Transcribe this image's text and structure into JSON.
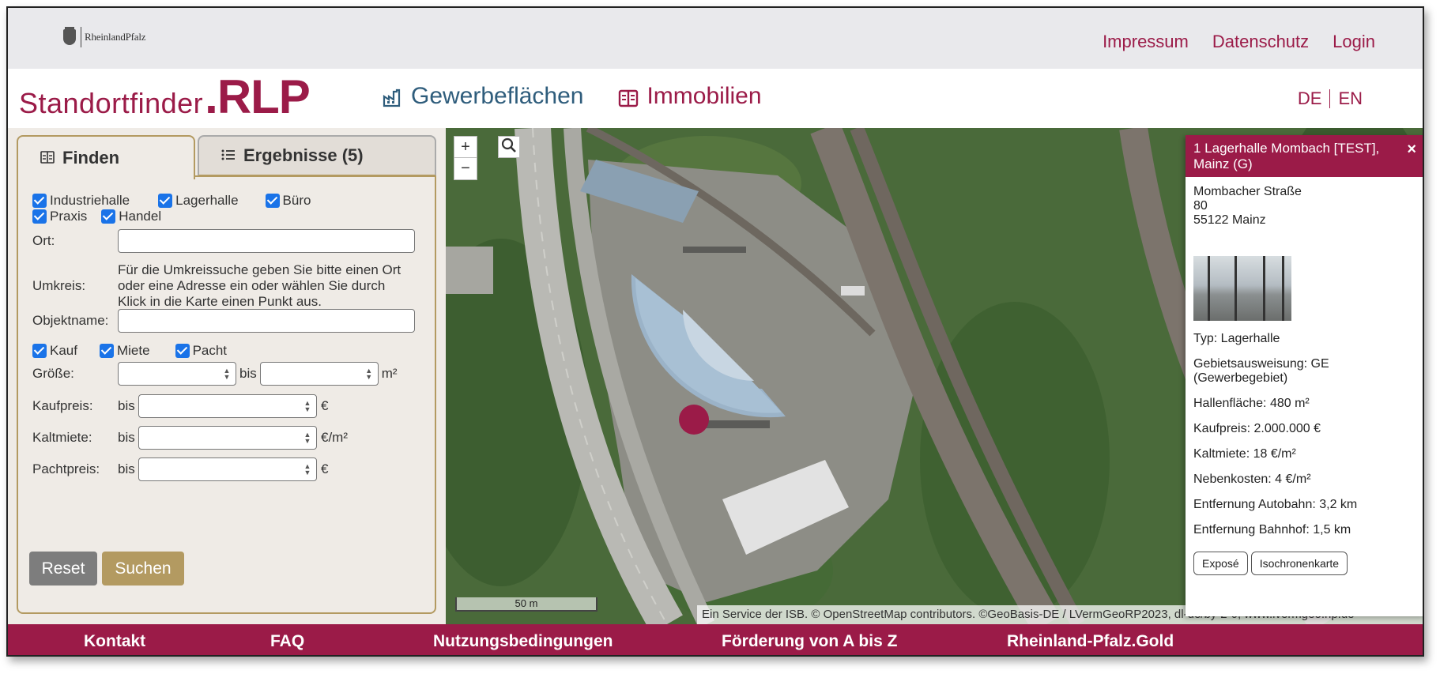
{
  "topbar": {
    "logo_text": "RheinlandPfalz",
    "links": [
      "Impressum",
      "Datenschutz",
      "Login"
    ]
  },
  "header": {
    "brand_prefix": "Standortfinder",
    "brand_suffix": ".RLP",
    "nav": [
      {
        "label": "Gewerbeflächen",
        "icon": "factory-icon"
      },
      {
        "label": "Immobilien",
        "icon": "building-icon"
      }
    ],
    "lang": [
      "DE",
      "EN"
    ]
  },
  "sidebar": {
    "tabs": [
      {
        "label": "Finden",
        "icon": "building-icon"
      },
      {
        "label": "Ergebnisse (5)",
        "icon": "list-icon"
      }
    ],
    "types": [
      {
        "label": "Industriehalle",
        "checked": true
      },
      {
        "label": "Lagerhalle",
        "checked": true
      },
      {
        "label": "Büro",
        "checked": true
      },
      {
        "label": "Praxis",
        "checked": true
      },
      {
        "label": "Handel",
        "checked": true
      }
    ],
    "ort_label": "Ort:",
    "ort_value": "",
    "umkreis_label": "Umkreis:",
    "umkreis_help": "Für die Umkreissuche geben Sie bitte einen Ort oder eine Adresse ein oder wählen Sie durch Klick in die Karte einen Punkt aus.",
    "objektname_label": "Objektname:",
    "objektname_value": "",
    "offer": [
      {
        "label": "Kauf",
        "checked": true
      },
      {
        "label": "Miete",
        "checked": true
      },
      {
        "label": "Pacht",
        "checked": true
      }
    ],
    "groesse_label": "Größe:",
    "bis": "bis",
    "unit_m2": "m²",
    "kaufpreis_label": "Kaufpreis:",
    "unit_eur": "€",
    "kaltmiete_label": "Kaltmiete:",
    "unit_eur_m2": "€/m²",
    "pachtpreis_label": "Pachtpreis:",
    "reset_label": "Reset",
    "search_label": "Suchen"
  },
  "map": {
    "zoom_in": "+",
    "zoom_out": "−",
    "scale_label": "50 m",
    "attribution": "Ein Service der ISB. © OpenStreetMap contributors. ©GeoBasis-DE / LVermGeoRP2023, dl-de/by-2-0, www.lvermgeo.rlp.de"
  },
  "card": {
    "title": "1 Lagerhalle Mombach [TEST], Mainz (G)",
    "close": "×",
    "address": [
      "Mombacher Straße",
      "80",
      "55122 Mainz"
    ],
    "props": [
      "Typ: Lagerhalle",
      "Gebietsausweisung: GE (Gewerbegebiet)",
      "Hallenfläche: 480 m²",
      "Kaufpreis: 2.000.000 €",
      "Kaltmiete: 18 €/m²",
      "Nebenkosten: 4 €/m²",
      "Entfernung Autobahn: 3,2 km",
      "Entfernung Bahnhof: 1,5 km"
    ],
    "buttons": [
      "Exposé",
      "Isochronenkarte"
    ]
  },
  "footer": [
    "Kontakt",
    "FAQ",
    "Nutzungsbedingungen",
    "Förderung von A bis Z",
    "Rheinland-Pfalz.Gold"
  ],
  "colors": {
    "brand": "#9b1b48",
    "gold": "#b39a61",
    "blue": "#2f5d7c"
  }
}
